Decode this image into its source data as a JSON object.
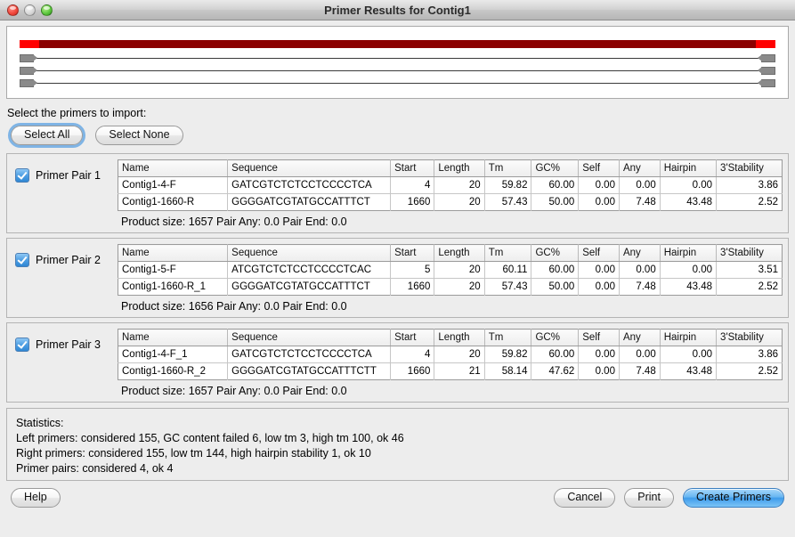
{
  "window": {
    "title": "Primer Results for Contig1",
    "traffic_lights": [
      "close-light",
      "minimize-light",
      "zoom-light"
    ]
  },
  "diagram": {
    "contig_track": {
      "left_cap_color": "#ff0000",
      "body_color": "#8b0000",
      "right_cap_color": "#ff0000"
    },
    "primer_rows": 3
  },
  "instruction": "Select the primers to import:",
  "select_buttons": {
    "select_all": "Select All",
    "select_none": "Select None"
  },
  "table_headers": [
    "Name",
    "Sequence",
    "Start",
    "Length",
    "Tm",
    "GC%",
    "Self",
    "Any",
    "Hairpin",
    "3'Stability"
  ],
  "primer_pairs": [
    {
      "label": "Primer Pair 1",
      "checked": true,
      "rows": [
        {
          "name": "Contig1-4-F",
          "sequence": "GATCGTCTCTCCTCCCCTCA",
          "start": "4",
          "length": "20",
          "tm": "59.82",
          "gc": "60.00",
          "self": "0.00",
          "any": "0.00",
          "hairpin": "0.00",
          "stability": "3.86"
        },
        {
          "name": "Contig1-1660-R",
          "sequence": "GGGGATCGTATGCCATTTCT",
          "start": "1660",
          "length": "20",
          "tm": "57.43",
          "gc": "50.00",
          "self": "0.00",
          "any": "7.48",
          "hairpin": "43.48",
          "stability": "2.52"
        }
      ],
      "summary": "Product size: 1657  Pair Any: 0.0  Pair End: 0.0"
    },
    {
      "label": "Primer Pair 2",
      "checked": true,
      "rows": [
        {
          "name": "Contig1-5-F",
          "sequence": "ATCGTCTCTCCTCCCCTCAC",
          "start": "5",
          "length": "20",
          "tm": "60.11",
          "gc": "60.00",
          "self": "0.00",
          "any": "0.00",
          "hairpin": "0.00",
          "stability": "3.51"
        },
        {
          "name": "Contig1-1660-R_1",
          "sequence": "GGGGATCGTATGCCATTTCT",
          "start": "1660",
          "length": "20",
          "tm": "57.43",
          "gc": "50.00",
          "self": "0.00",
          "any": "7.48",
          "hairpin": "43.48",
          "stability": "2.52"
        }
      ],
      "summary": "Product size: 1656  Pair Any: 0.0  Pair End: 0.0"
    },
    {
      "label": "Primer Pair 3",
      "checked": true,
      "rows": [
        {
          "name": "Contig1-4-F_1",
          "sequence": "GATCGTCTCTCCTCCCCTCA",
          "start": "4",
          "length": "20",
          "tm": "59.82",
          "gc": "60.00",
          "self": "0.00",
          "any": "0.00",
          "hairpin": "0.00",
          "stability": "3.86"
        },
        {
          "name": "Contig1-1660-R_2",
          "sequence": "GGGGATCGTATGCCATTTCTT",
          "start": "1660",
          "length": "21",
          "tm": "58.14",
          "gc": "47.62",
          "self": "0.00",
          "any": "7.48",
          "hairpin": "43.48",
          "stability": "2.52"
        }
      ],
      "summary": "Product size: 1657  Pair Any: 0.0  Pair End: 0.0"
    }
  ],
  "statistics": [
    "Statistics:",
    "Left primers: considered 155, GC content failed 6, low tm 3, high tm 100, ok 46",
    "Right primers: considered 155, low tm 144, high hairpin stability 1, ok 10",
    "Primer pairs: considered 4, ok 4"
  ],
  "bottom_buttons": {
    "help": "Help",
    "cancel": "Cancel",
    "print": "Print",
    "create_primers": "Create Primers"
  },
  "colors": {
    "default_button": "#3f9ceb",
    "focus_ring": "#5aa0e1",
    "checkbox": "#2f87d4",
    "contig_highlight": "#ff0000",
    "contig_body": "#8b0000"
  }
}
